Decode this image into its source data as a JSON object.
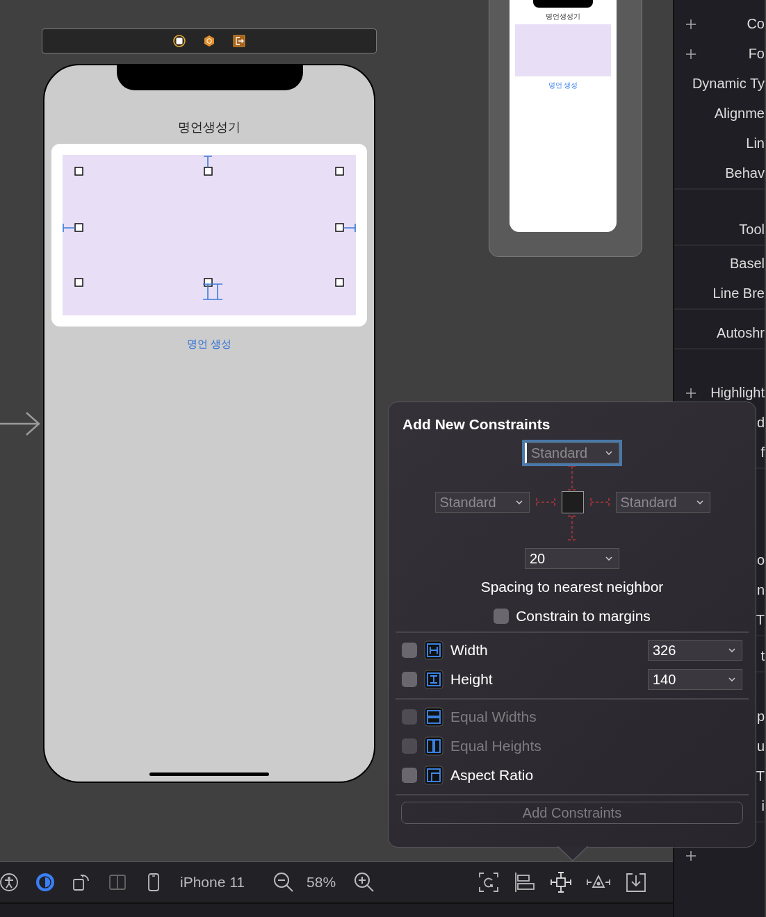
{
  "scene": {
    "title": "명언생성기",
    "button": "명언 생성"
  },
  "preview": {
    "title": "명언생성기",
    "button": "명언 생성"
  },
  "inspector": {
    "sections": [
      [
        {
          "label": "Co",
          "add": true
        },
        {
          "label": "Fo",
          "add": true
        },
        {
          "label": "Dynamic Ty",
          "add": false
        },
        {
          "label": "Alignme",
          "add": false
        },
        {
          "label": "Lin",
          "add": false
        },
        {
          "label": "Behav",
          "add": false
        }
      ],
      [
        {
          "label": "Tool",
          "add": false
        }
      ],
      [
        {
          "label": "Basel",
          "add": false
        },
        {
          "label": "Line Bre",
          "add": false
        }
      ],
      [
        {
          "label": "Autoshr",
          "add": false
        }
      ],
      [
        {
          "label": "Highlight",
          "add": true
        },
        {
          "label": "d",
          "add": false
        },
        {
          "label": "f",
          "add": false
        }
      ],
      [
        {
          "label": "o",
          "add": false
        },
        {
          "label": "n",
          "add": false
        },
        {
          "label": "T",
          "add": false
        }
      ],
      [
        {
          "label": "t",
          "add": false
        }
      ],
      [
        {
          "label": "p",
          "add": false
        },
        {
          "label": "u",
          "add": false
        },
        {
          "label": "T",
          "add": false
        },
        {
          "label": "i",
          "add": false
        }
      ],
      [
        {
          "add": true
        }
      ]
    ]
  },
  "toolbar": {
    "device": "iPhone 11",
    "zoom": "58%"
  },
  "popover": {
    "title": "Add New Constraints",
    "top": {
      "placeholder": "Standard",
      "focused": true
    },
    "left": {
      "placeholder": "Standard",
      "focused": false
    },
    "right": {
      "placeholder": "Standard",
      "focused": false
    },
    "bottom": {
      "value": "20",
      "focused": false
    },
    "caption": "Spacing to nearest neighbor",
    "margins": {
      "label": "Constrain to margins",
      "checked": false
    },
    "size_rows": [
      {
        "kind": "width",
        "label": "Width",
        "checked": false,
        "value": "326"
      },
      {
        "kind": "height",
        "label": "Height",
        "checked": false,
        "value": "140"
      }
    ],
    "relation_rows": [
      {
        "kind": "equal-widths",
        "label": "Equal Widths",
        "checked": false,
        "disabled": true
      },
      {
        "kind": "equal-heights",
        "label": "Equal Heights",
        "checked": false,
        "disabled": true
      },
      {
        "kind": "aspect",
        "label": "Aspect Ratio",
        "checked": false,
        "disabled": false
      }
    ],
    "button": {
      "label": "Add Constraints",
      "disabled": true
    }
  }
}
